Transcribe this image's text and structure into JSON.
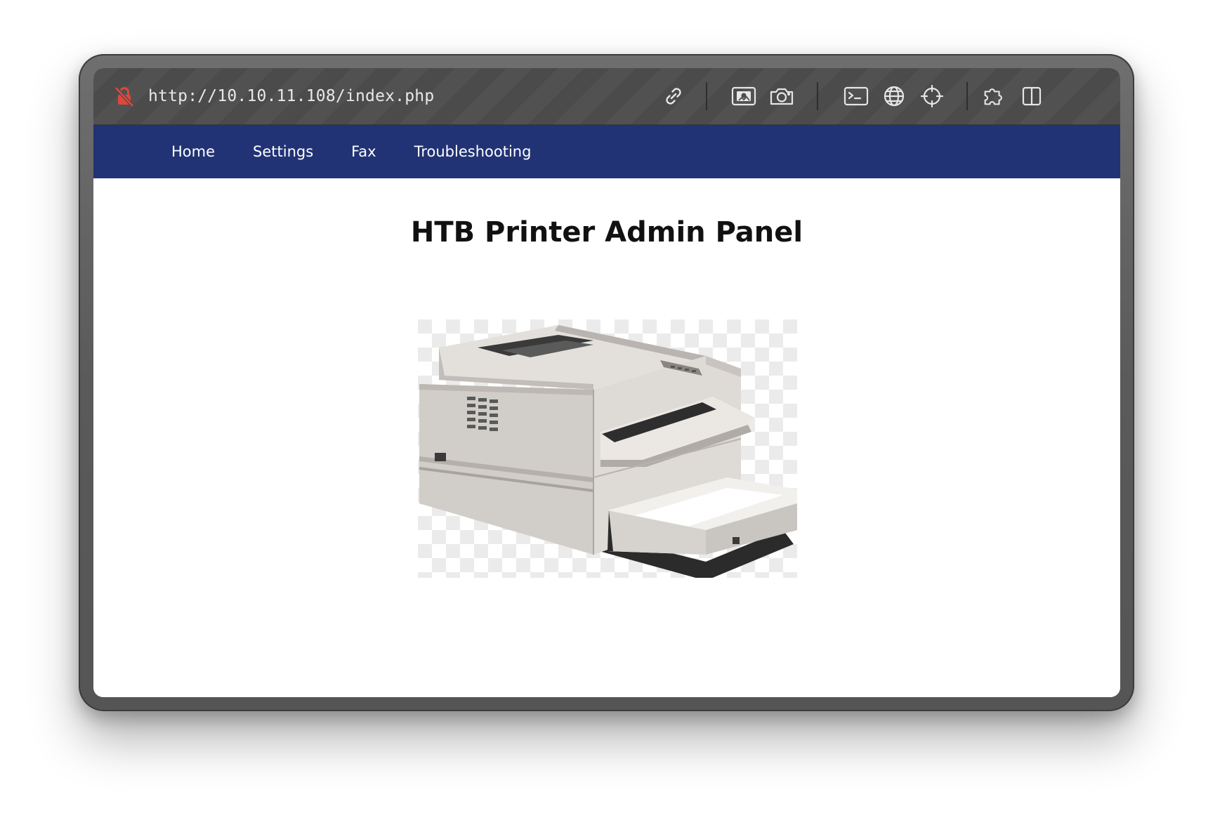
{
  "browser": {
    "url": "http://10.10.11.108/index.php",
    "security_icon": "lock-slash-icon",
    "toolbar_icons": [
      "link-icon",
      "image-icon",
      "camera-icon",
      "terminal-icon",
      "globe-icon",
      "crosshair-icon",
      "extension-icon",
      "split-view-icon"
    ]
  },
  "nav": {
    "items": [
      {
        "label": "Home"
      },
      {
        "label": "Settings"
      },
      {
        "label": "Fax"
      },
      {
        "label": "Troubleshooting"
      }
    ],
    "background_color": "#213374"
  },
  "page": {
    "title": "HTB Printer Admin Panel",
    "image": "printer-image"
  }
}
